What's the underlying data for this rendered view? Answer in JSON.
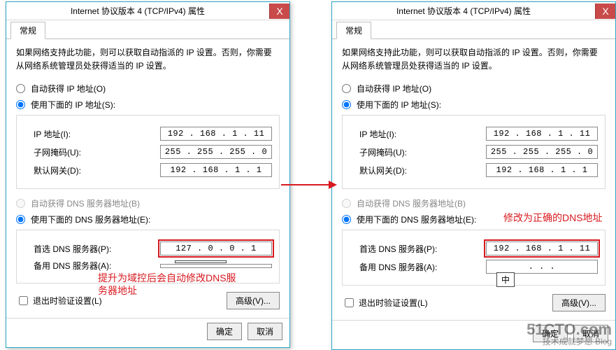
{
  "dialog": {
    "title": "Internet 协议版本 4 (TCP/IPv4) 属性",
    "close": "X",
    "tab": "常规",
    "intro": "如果网络支持此功能，则可以获取自动指派的 IP 设置。否则，你需要从网络系统管理员处获得适当的 IP 设置。",
    "radio_auto_ip": "自动获得 IP 地址(O)",
    "radio_manual_ip": "使用下面的 IP 地址(S):",
    "ip_label": "IP 地址(I):",
    "mask_label": "子网掩码(U):",
    "gw_label": "默认网关(D):",
    "radio_auto_dns": "自动获得 DNS 服务器地址(B)",
    "radio_manual_dns": "使用下面的 DNS 服务器地址(E):",
    "dns1_label": "首选 DNS 服务器(P):",
    "dns2_label": "备用 DNS 服务器(A):",
    "validate_label": "退出时验证设置(L)",
    "advanced": "高级(V)...",
    "ok": "确定",
    "cancel": "取消"
  },
  "left": {
    "ip": "192 . 168 .  1  . 11",
    "mask": "255 . 255 . 255 .  0",
    "gw": "192 . 168 .  1  .  1",
    "dns1": "127 .  0  .  0  .  1",
    "dns2": "",
    "annot": "提升为域控后会自动修改DNS服务器地址",
    "ime": ""
  },
  "right": {
    "ip": "192 . 168 .  1  . 11",
    "mask": "255 . 255 . 255 .  0",
    "gw": "192 . 168 .  1  .  1",
    "dns1": "192 . 168 .  1  . 11",
    "dns2": "   .     .     .   ",
    "annot": "修改为正确的DNS地址",
    "ime": "中"
  },
  "watermark": {
    "main": "51CTO.com",
    "sub": "技术成就梦想 Blog"
  }
}
